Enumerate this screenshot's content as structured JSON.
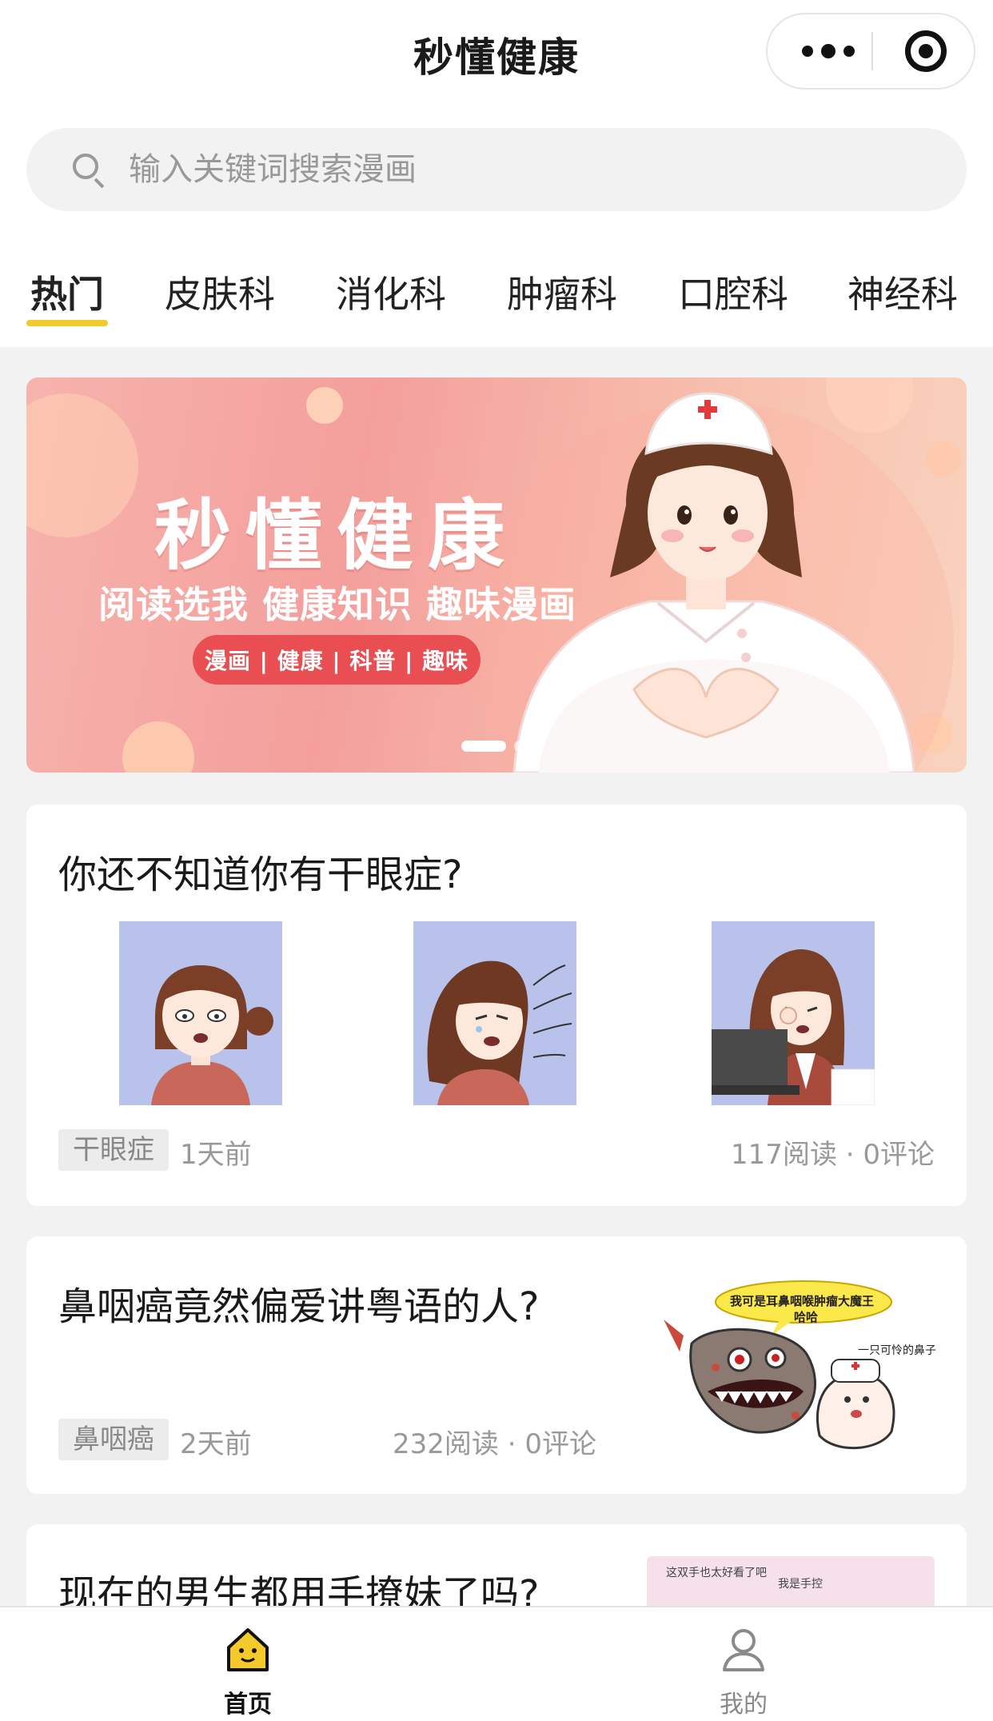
{
  "app": {
    "title": "秒懂健康"
  },
  "search": {
    "placeholder": "输入关键词搜索漫画"
  },
  "tabs": [
    {
      "label": "热门",
      "active": true
    },
    {
      "label": "皮肤科"
    },
    {
      "label": "消化科"
    },
    {
      "label": "肿瘤科"
    },
    {
      "label": "口腔科"
    },
    {
      "label": "神经科"
    }
  ],
  "banner": {
    "title": "秒懂健康",
    "subtitle": "阅读选我 健康知识 趣味漫画",
    "pill": "漫画 | 健康 | 科普 | 趣味",
    "slides_total": 2,
    "slide_active": 1
  },
  "articles": [
    {
      "title": "你还不知道你有干眼症?",
      "tag": "干眼症",
      "time": "1天前",
      "stats": "117阅读 · 0评论"
    },
    {
      "title": "鼻咽癌竟然偏爱讲粤语的人?",
      "tag": "鼻咽癌",
      "time": "2天前",
      "stats": "232阅读 · 0评论",
      "image_text": {
        "bubble1": "我可是耳鼻咽喉肿瘤大魔王",
        "bubble1b": "哈哈",
        "bubble2": "一只可怜的鼻子"
      }
    },
    {
      "title": "现在的男生都用手撩妹了吗?",
      "image_text": {
        "a": "这双手也太好看了吧",
        "b": "我是手控"
      }
    }
  ],
  "bottom_nav": [
    {
      "label": "首页",
      "active": true
    },
    {
      "label": "我的"
    }
  ],
  "colors": {
    "accent": "#f4c92b",
    "banner_pill": "#e84e52",
    "thumb_bg": "#b8c2ea"
  }
}
